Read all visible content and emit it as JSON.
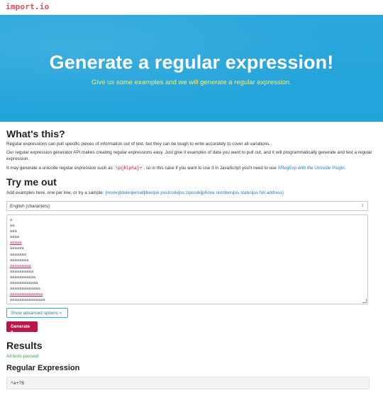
{
  "nav": {
    "logo_main": "import",
    "logo_dot": ".",
    "logo_tail": "io"
  },
  "hero": {
    "title": "Generate a regular expression!",
    "subtitle": "Give us some examples and we will generate a regular expression."
  },
  "whats_this": {
    "heading": "What's this?",
    "p1": "Regular expressions can pull specific pieces of information out of text, but they can be tough to write accurately to cover all variations.",
    "p2": "Our regular expression generator API makes creating regular expressions easy. Just give it examples of data you want to pull out, and it will programmatically generate and test a regular expression.",
    "p3_before": "It may generate a unicode regular expression such as ",
    "p3_code": "\\p{Alpha}+",
    "p3_middle": ", so in this case if you want to use it in JavaScript you'll need to use ",
    "p3_link": "XRegExp with the Unicode Plugin",
    "p3_after": "."
  },
  "try_me": {
    "heading": "Try me out",
    "samples_intro": "Add examples here, one per line, or try a sample: ",
    "samples_links": [
      "[money",
      "dates",
      "email",
      "iban",
      "uk postcode",
      "us zipcode",
      "phone numbers",
      "us states",
      "us full address]"
    ],
    "select_value": "English (characters)",
    "examples": [
      "a",
      "aa",
      "aaa",
      "aaaa",
      "aaaaa",
      "aaaaaa",
      "aaaaaaa",
      "aaaaaaaa",
      "aaaaaaaaa",
      "aaaaaaaaaa",
      "aaaaaaaaaaa",
      "aaaaaaaaaaaa",
      "aaaaaaaaaaaaa",
      "aaaaaaaaaaaaaa",
      "aaaaaaaaaaaaaaa"
    ],
    "highlighted_rows": [
      4,
      8,
      13
    ],
    "advanced_label": "Show advanced options »",
    "generate_label": "Generate »"
  },
  "results": {
    "heading": "Results",
    "status": "All tests passed!",
    "regex_heading": "Regular Expression",
    "regex_value": "^a+?$"
  },
  "colors": {
    "hero_bg": "#22a3da",
    "subtitle": "#f3f07a",
    "generate_bg": "#b8174a",
    "link": "#2a7ab8",
    "success": "#3a9a4a",
    "logo": "#e04a5a"
  }
}
